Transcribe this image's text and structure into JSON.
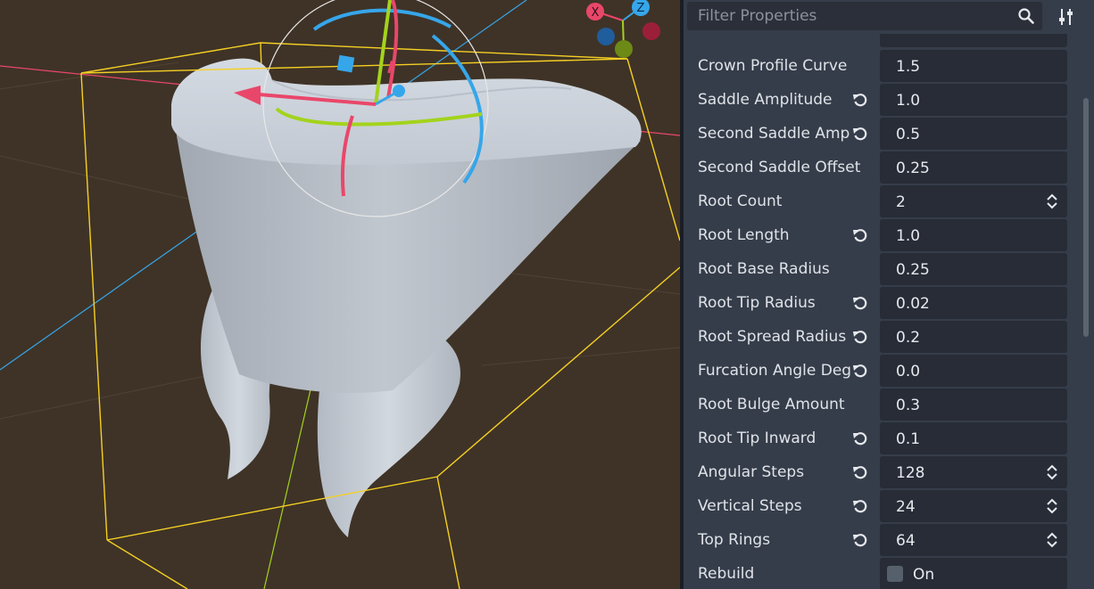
{
  "viewport": {
    "gizmo": {
      "x_label": "X",
      "z_label": "Z"
    }
  },
  "inspector": {
    "filter_placeholder": "Filter Properties",
    "properties": [
      {
        "label": "Crown Profile Curve",
        "value": "1.5",
        "revert": false,
        "spin": false
      },
      {
        "label": "Saddle Amplitude",
        "value": "1.0",
        "revert": true,
        "spin": false
      },
      {
        "label": "Second Saddle Amp",
        "value": "0.5",
        "revert": true,
        "spin": false
      },
      {
        "label": "Second Saddle Offset",
        "value": "0.25",
        "revert": false,
        "spin": false
      },
      {
        "label": "Root Count",
        "value": "2",
        "revert": false,
        "spin": true
      },
      {
        "label": "Root Length",
        "value": "1.0",
        "revert": true,
        "spin": false
      },
      {
        "label": "Root Base Radius",
        "value": "0.25",
        "revert": false,
        "spin": false
      },
      {
        "label": "Root Tip Radius",
        "value": "0.02",
        "revert": true,
        "spin": false
      },
      {
        "label": "Root Spread Radius",
        "value": "0.2",
        "revert": true,
        "spin": false
      },
      {
        "label": "Furcation Angle Deg",
        "value": "0.0",
        "revert": true,
        "spin": false
      },
      {
        "label": "Root Bulge Amount",
        "value": "0.3",
        "revert": false,
        "spin": false
      },
      {
        "label": "Root Tip Inward",
        "value": "0.1",
        "revert": true,
        "spin": false
      },
      {
        "label": "Angular Steps",
        "value": "128",
        "revert": true,
        "spin": true
      },
      {
        "label": "Vertical Steps",
        "value": "24",
        "revert": true,
        "spin": true
      },
      {
        "label": "Top Rings",
        "value": "64",
        "revert": true,
        "spin": true
      }
    ],
    "rebuild": {
      "label": "Rebuild",
      "checkbox_label": "On",
      "checked": false
    }
  },
  "colors": {
    "viewport_bg": "#3f3327",
    "panel_bg": "#363d4a",
    "field_bg": "#272c36",
    "selection_box": "#f5d023",
    "axis_x": "#e9476a",
    "axis_y": "#a3d31c",
    "axis_z": "#36a6ea"
  },
  "icons": {
    "search": "search-icon",
    "tune": "tune-icon",
    "revert": "revert-icon",
    "spin": "spin-updown-icon"
  }
}
